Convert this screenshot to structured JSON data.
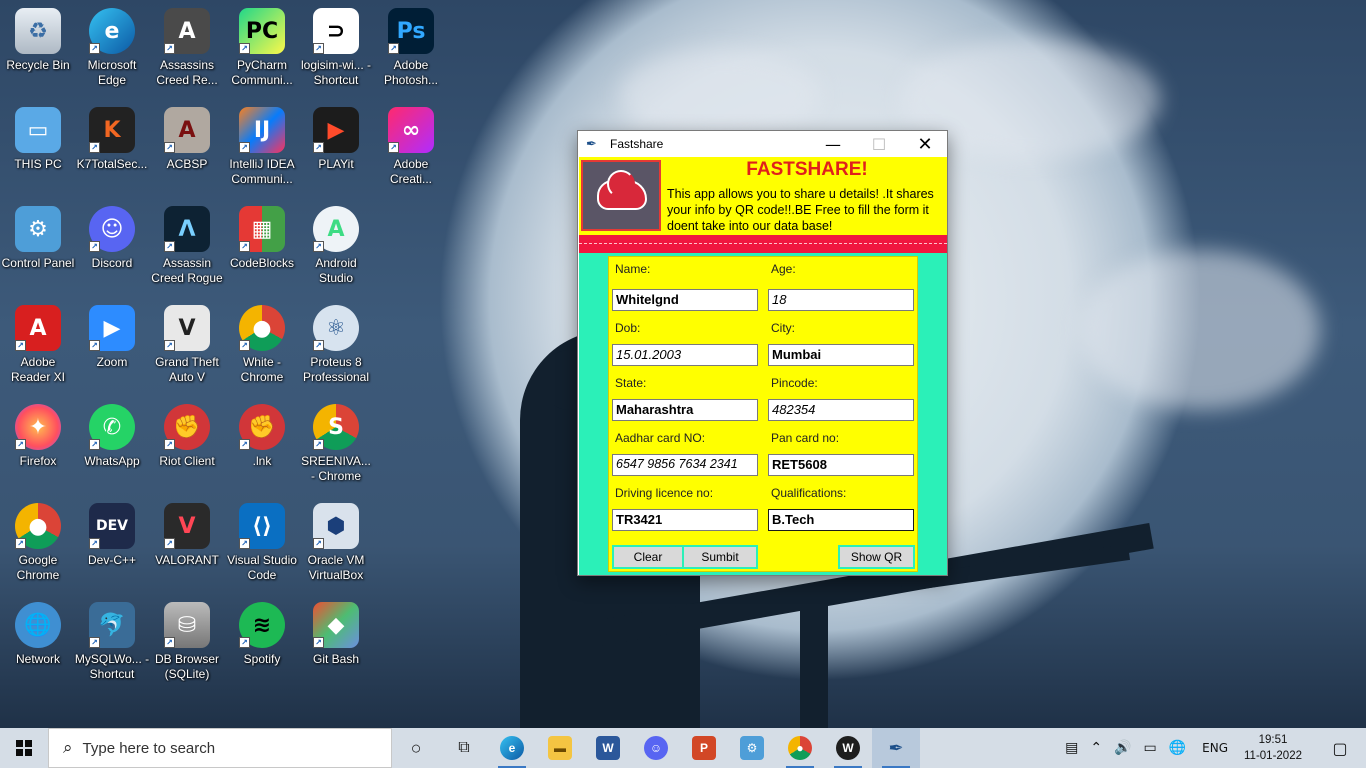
{
  "desktop": {
    "icons": [
      {
        "label": "Recycle Bin",
        "icon": "recycle-bin-icon"
      },
      {
        "label": "Microsoft Edge",
        "icon": "edge-icon"
      },
      {
        "label": "Assassins Creed Re...",
        "icon": "assassins-creed-icon"
      },
      {
        "label": "PyCharm Communi...",
        "icon": "pycharm-icon"
      },
      {
        "label": "logisim-wi... - Shortcut",
        "icon": "logisim-icon"
      },
      {
        "label": "Adobe Photosh...",
        "icon": "photoshop-icon"
      },
      {
        "label": "THIS PC",
        "icon": "this-pc-icon"
      },
      {
        "label": "K7TotalSec...",
        "icon": "k7-icon"
      },
      {
        "label": "ACBSP",
        "icon": "acbsp-icon"
      },
      {
        "label": "IntelliJ IDEA Communi...",
        "icon": "intellij-icon"
      },
      {
        "label": "PLAYit",
        "icon": "playit-icon"
      },
      {
        "label": "Adobe Creati...",
        "icon": "adobe-cc-icon"
      },
      {
        "label": "Control Panel",
        "icon": "control-panel-icon"
      },
      {
        "label": "Discord",
        "icon": "discord-icon"
      },
      {
        "label": "Assassin Creed Rogue",
        "icon": "ac-rogue-icon"
      },
      {
        "label": "CodeBlocks",
        "icon": "codeblocks-icon"
      },
      {
        "label": "Android Studio",
        "icon": "android-studio-icon"
      },
      {
        "label": "Adobe Reader XI",
        "icon": "adobe-reader-icon"
      },
      {
        "label": "Zoom",
        "icon": "zoom-icon"
      },
      {
        "label": "Grand Theft Auto V",
        "icon": "gta-icon"
      },
      {
        "label": "White - Chrome",
        "icon": "chrome-profile-icon"
      },
      {
        "label": "Proteus 8 Professional",
        "icon": "proteus-icon"
      },
      {
        "label": "Firefox",
        "icon": "firefox-icon"
      },
      {
        "label": "WhatsApp",
        "icon": "whatsapp-icon"
      },
      {
        "label": "Riot Client",
        "icon": "riot-client-icon"
      },
      {
        "label": ".lnk",
        "icon": "riot-lnk-icon"
      },
      {
        "label": "SREENIVA... - Chrome",
        "icon": "chrome-profile-s-icon"
      },
      {
        "label": "Google Chrome",
        "icon": "chrome-icon"
      },
      {
        "label": "Dev-C++",
        "icon": "devcpp-icon"
      },
      {
        "label": "VALORANT",
        "icon": "valorant-icon"
      },
      {
        "label": "Visual Studio Code",
        "icon": "vscode-icon"
      },
      {
        "label": "Oracle VM VirtualBox",
        "icon": "virtualbox-icon"
      },
      {
        "label": "Network",
        "icon": "network-icon"
      },
      {
        "label": "MySQLWo... - Shortcut",
        "icon": "mysql-workbench-icon"
      },
      {
        "label": "DB Browser (SQLite)",
        "icon": "db-browser-icon"
      },
      {
        "label": "Spotify",
        "icon": "spotify-icon"
      },
      {
        "label": "Git Bash",
        "icon": "git-bash-icon"
      }
    ]
  },
  "window": {
    "title": "Fastshare",
    "icon": "feather-icon",
    "header": {
      "title": "FASTSHARE!",
      "description": "This app allows you to share u details! .It shares your info by QR code!!.BE Free to fill the form it doent take into our data base!"
    },
    "form": {
      "name_label": "Name:",
      "name_value": "Whitelgnd",
      "age_label": "Age:",
      "age_value": "18",
      "dob_label": "Dob:",
      "dob_value": "15.01.2003",
      "city_label": "City:",
      "city_value": "Mumbai",
      "state_label": "State:",
      "state_value": "Maharashtra",
      "pincode_label": "Pincode:",
      "pincode_value": "482354",
      "aadhar_label": "Aadhar card NO:",
      "aadhar_value": "6547 9856 7634 2341",
      "pan_label": "Pan card no:",
      "pan_value": "RET5608",
      "licence_label": "Driving licence no:",
      "licence_value": "TR3421",
      "qual_label": "Qualifications:",
      "qual_value": "B.Tech"
    },
    "buttons": {
      "clear": "Clear",
      "submit": "Sumbit",
      "show_qr": "Show QR"
    }
  },
  "taskbar": {
    "search_placeholder": "Type here to search",
    "language": "ENG",
    "time": "19:51",
    "date": "11-01-2022",
    "pinned": [
      "task-view-icon",
      "edge-icon",
      "file-explorer-icon",
      "word-icon",
      "discord-icon",
      "powerpoint-icon",
      "control-panel-icon",
      "chrome-icon",
      "writer-icon",
      "python-tk-icon"
    ]
  },
  "colors": {
    "header_bg": "#ffff00",
    "title_red": "#e0201c",
    "band_red": "#f0173f",
    "body_bg": "#2bf0b8"
  }
}
